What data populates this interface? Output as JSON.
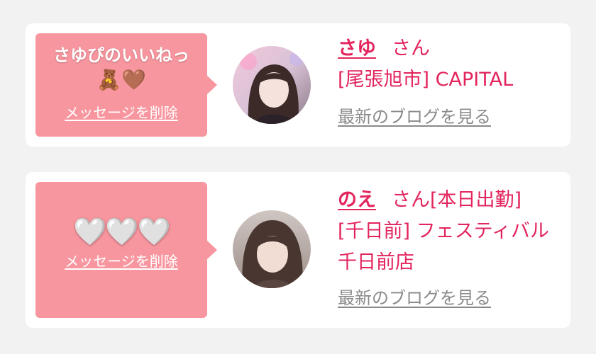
{
  "messages": [
    {
      "bubble_text": "さゆぴのいいねっ",
      "bubble_emoji": "🧸🤎",
      "delete_label": "メッセージを削除",
      "name": "さゆ",
      "honorific": "さん",
      "status": "",
      "shop": "[尾張旭市] CAPITAL",
      "blog_link": "最新のブログを見る",
      "avatar_icon": "profile-photo"
    },
    {
      "bubble_hearts": "🤍🤍🤍",
      "delete_label": "メッセージを削除",
      "name": "のえ",
      "honorific": "さん",
      "status": "[本日出勤]",
      "shop_line1": "[千日前] フェスティバル",
      "shop_line2": "千日前店",
      "blog_link": "最新のブログを見る",
      "avatar_icon": "profile-photo"
    }
  ],
  "colors": {
    "background": "#f2f2f2",
    "bubble": "#f8969f",
    "accent": "#e3245d",
    "link_gray": "#8a8a8a"
  }
}
